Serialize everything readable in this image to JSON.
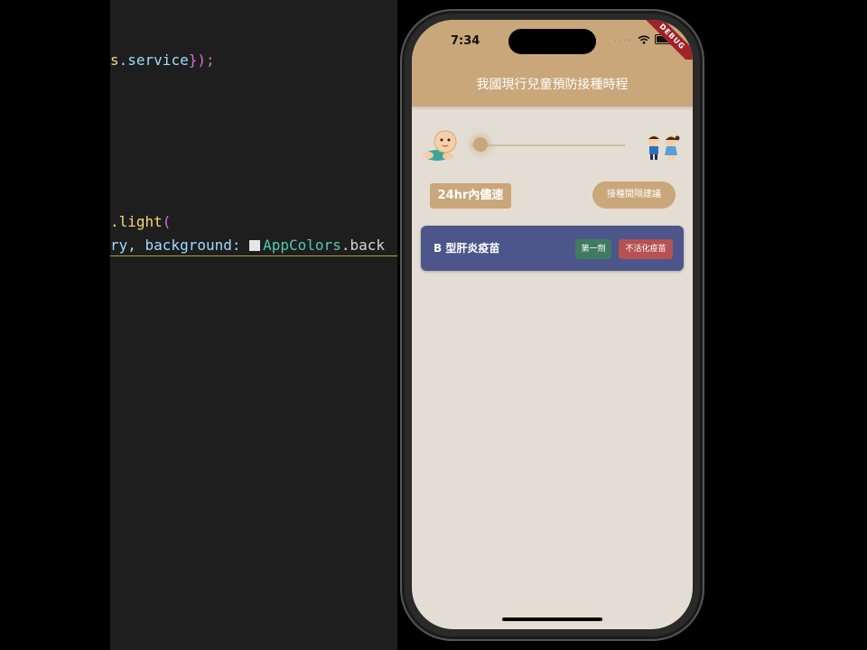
{
  "editor": {
    "lines": [
      {
        "a": "s",
        "b": ".service",
        "c": "});"
      },
      {
        "a": ".light",
        "b": "(",
        "c": ""
      },
      {
        "a": "ry, background: ",
        "b": "AppColors",
        "c": ".back"
      }
    ]
  },
  "status_bar": {
    "time": "7:34",
    "signal": "····"
  },
  "debug_banner": "DEBUG",
  "app_bar": {
    "title": "我國現行兒童預防接種時程"
  },
  "age_slider": {
    "value_fraction": 0.0,
    "start_icon": "baby-crawling-icon",
    "end_icon": "children-icon"
  },
  "filter": {
    "chip_label": "24hr內儘速",
    "interval_button_label": "接種間隔建議"
  },
  "vaccine_list": [
    {
      "name": "B 型肝炎疫苗",
      "dose": "第一劑",
      "type": "不活化疫苗"
    }
  ],
  "colors": {
    "app_bar": "#c9a77a",
    "background": "#e3ddd3",
    "card": "#4c568a",
    "dose_tag": "#3f7b62",
    "type_tag": "#b75252",
    "debug": "#a0232a"
  }
}
